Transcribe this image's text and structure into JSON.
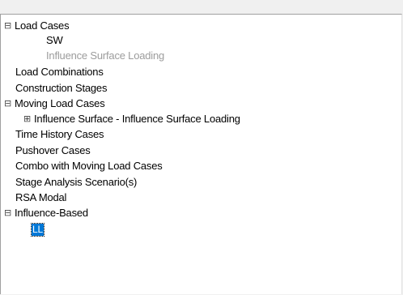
{
  "tree": {
    "items": [
      {
        "label": "Load Cases",
        "toggle": "⊟"
      },
      {
        "label": "SW"
      },
      {
        "label": "Influence Surface Loading"
      },
      {
        "label": "Load Combinations"
      },
      {
        "label": "Construction Stages"
      },
      {
        "label": "Moving Load Cases",
        "toggle": "⊟"
      },
      {
        "label": "Influence Surface - Influence Surface Loading",
        "toggle": "⊞"
      },
      {
        "label": "Time History Cases"
      },
      {
        "label": "Pushover Cases"
      },
      {
        "label": "Combo with Moving Load Cases"
      },
      {
        "label": "Stage Analysis Scenario(s)"
      },
      {
        "label": "RSA Modal"
      },
      {
        "label": "Influence-Based",
        "toggle": "⊟"
      },
      {
        "label": "LL"
      }
    ]
  },
  "colors": {
    "selection": "#0078d7",
    "disabled_text": "#9c9c9c"
  }
}
